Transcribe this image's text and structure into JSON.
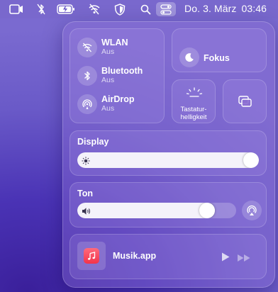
{
  "menubar": {
    "icons": [
      "screen-mirroring-icon",
      "bluetooth-off-icon",
      "battery-icon",
      "wifi-off-icon",
      "shield-icon",
      "spotlight-search-icon",
      "control-center-icon"
    ],
    "date": "Do. 3. März",
    "time": "03:46"
  },
  "control_center": {
    "connectivity": [
      {
        "title": "WLAN",
        "status": "Aus",
        "icon": "wifi-off-icon"
      },
      {
        "title": "Bluetooth",
        "status": "Aus",
        "icon": "bluetooth-icon"
      },
      {
        "title": "AirDrop",
        "status": "Aus",
        "icon": "airdrop-icon"
      }
    ],
    "focus": {
      "label": "Fokus",
      "icon": "moon-icon"
    },
    "keyboard": {
      "label_line1": "Tastatur-",
      "label_line2": "helligkeit",
      "icon": "keyboard-brightness-icon"
    },
    "screen_mirroring": {
      "icon": "screen-mirroring-icon"
    },
    "display": {
      "label": "Display",
      "level": 1.0,
      "icon": "sun-icon"
    },
    "sound": {
      "label": "Ton",
      "level": 0.85,
      "icon": "speaker-icon",
      "output_icon": "airplay-audio-icon"
    },
    "now_playing": {
      "app": "Musik.app",
      "icon": "music-note-icon",
      "controls": [
        "play-icon",
        "fast-forward-icon"
      ]
    }
  },
  "colors": {
    "accent_music": "#f2334a",
    "panel_tint": "#8c6ed2",
    "wallpaper": "#4a33b5"
  }
}
